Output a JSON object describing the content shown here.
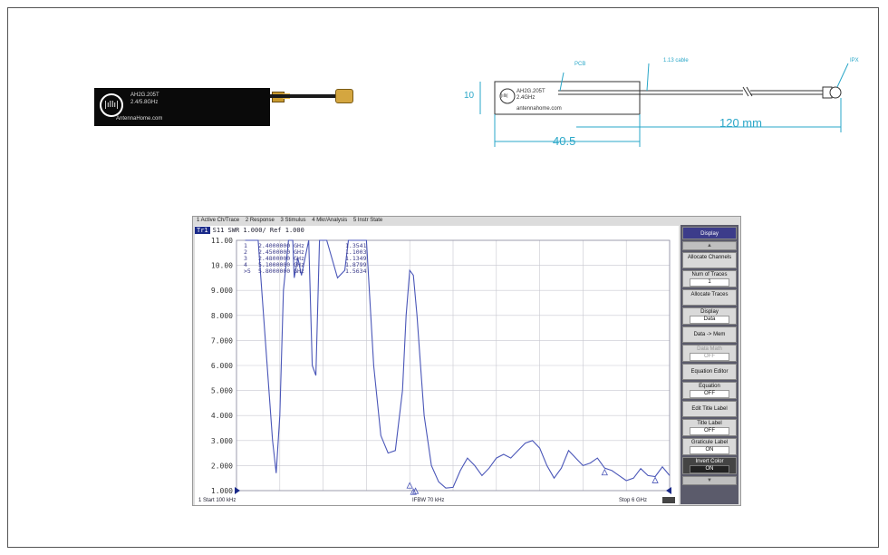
{
  "antenna_photo": {
    "model": "AH2G.205T",
    "freq": "2.4/5.8GHz",
    "website": "AntennaHome.com",
    "logo_text": "|ıllı|"
  },
  "drawing": {
    "labels": {
      "pcb": "PCB",
      "cable": "1.13 cable",
      "connector": "IPX"
    },
    "pcb_logo": "|ıllı|",
    "pcb_model": "AH2G.205T",
    "pcb_freq": "2.4GHz",
    "pcb_web": "antennahome.com",
    "dim_height": "10",
    "dim_pcb_length": "40.5",
    "dim_cable_length": "120 mm"
  },
  "vna": {
    "menu": [
      "1 Active Ch/Trace",
      "2 Response",
      "3 Stimulus",
      "4 Mkr/Analysis",
      "5 Instr State"
    ],
    "trace_tag": "Tr1",
    "trace_info": "S11  SWR 1.000/ Ref 1.000",
    "status": {
      "start": "1  Start 100 kHz",
      "ifbw": "IFBW 70 kHz",
      "stop": "Stop 6 GHz"
    },
    "markers": [
      {
        "id": "1",
        "freq": "2.4000000 GHz",
        "value": "1.3541"
      },
      {
        "id": "2",
        "freq": "2.4500000 GHz",
        "value": "1.1003"
      },
      {
        "id": "3",
        "freq": "2.4800000 GHz",
        "value": "1.1349"
      },
      {
        "id": "4",
        "freq": "5.1000000 GHz",
        "value": "1.8799"
      },
      {
        "id": ">5",
        "freq": "5.8000000 GHz",
        "value": "1.5634"
      }
    ],
    "softkeys": {
      "title": "Display",
      "allocate_channels": "Allocate Channels",
      "num_traces": "Num of Traces",
      "num_traces_val": "1",
      "allocate_traces": "Allocate Traces",
      "display": "Display",
      "display_val": "Data",
      "data_to_mem": "Data -> Mem",
      "data_math": "Data Math",
      "data_math_val": "OFF",
      "equation_editor": "Equation Editor",
      "equation": "Equation",
      "equation_val": "OFF",
      "edit_title_label": "Edit Title Label",
      "title_label": "Title Label",
      "title_label_val": "OFF",
      "graticule_label": "Graticule Label",
      "graticule_label_val": "ON",
      "invert_color": "Invert Color",
      "invert_color_val": "ON",
      "scroll_up": "▲",
      "scroll_down": "▼"
    }
  },
  "chart_data": {
    "type": "line",
    "title": "",
    "xlabel": "",
    "ylabel": "",
    "xlim": [
      0.0001,
      6
    ],
    "ylim": [
      1.0,
      11.0
    ],
    "y_ticks": [
      "11.00",
      "10.00",
      "9.000",
      "8.000",
      "7.000",
      "6.000",
      "5.000",
      "4.000",
      "3.000",
      "2.000",
      "1.000"
    ],
    "grid": true,
    "series": [
      {
        "x": [
          0.12,
          0.3,
          0.5,
          0.55,
          0.6,
          0.65,
          0.72,
          0.78,
          0.8,
          0.85,
          0.9,
          0.95,
          1.0,
          1.05,
          1.1,
          1.15,
          1.25,
          1.4,
          1.5,
          1.55,
          1.6,
          1.7,
          1.8,
          1.9,
          2.0,
          2.1,
          2.2,
          2.3,
          2.35,
          2.4,
          2.45,
          2.5,
          2.55,
          2.6,
          2.7,
          2.8,
          2.9,
          3.0,
          3.1,
          3.2,
          3.3,
          3.4,
          3.5,
          3.6,
          3.7,
          3.8,
          3.9,
          4.0,
          4.1,
          4.2,
          4.3,
          4.4,
          4.5,
          4.6,
          4.7,
          4.8,
          4.9,
          5.0,
          5.1,
          5.2,
          5.3,
          5.4,
          5.5,
          5.6,
          5.7,
          5.8,
          5.9,
          6.0
        ],
        "y": [
          11.0,
          11.0,
          3.0,
          1.7,
          4.0,
          9.0,
          11.0,
          11.0,
          9.5,
          10.3,
          9.6,
          10.3,
          11.0,
          6.0,
          5.6,
          11.0,
          11.0,
          9.5,
          9.8,
          11.0,
          11.0,
          11.0,
          11.0,
          6.0,
          3.2,
          2.5,
          2.6,
          5.0,
          8.0,
          9.8,
          9.6,
          8.0,
          6.0,
          4.0,
          2.0,
          1.35,
          1.1,
          1.13,
          1.8,
          2.3,
          2.0,
          1.6,
          1.9,
          2.3,
          2.45,
          2.3,
          2.6,
          2.9,
          3.0,
          2.7,
          2.0,
          1.5,
          1.9,
          2.6,
          2.3,
          2.0,
          2.1,
          2.3,
          1.9,
          1.8,
          1.6,
          1.4,
          1.5,
          1.88,
          1.6,
          1.56,
          1.95,
          1.6
        ]
      }
    ],
    "marker_points": [
      {
        "x": 2.4,
        "y": 1.3541
      },
      {
        "x": 2.45,
        "y": 1.1003
      },
      {
        "x": 2.48,
        "y": 1.1349
      },
      {
        "x": 5.1,
        "y": 1.8799
      },
      {
        "x": 5.8,
        "y": 1.5634
      }
    ]
  }
}
